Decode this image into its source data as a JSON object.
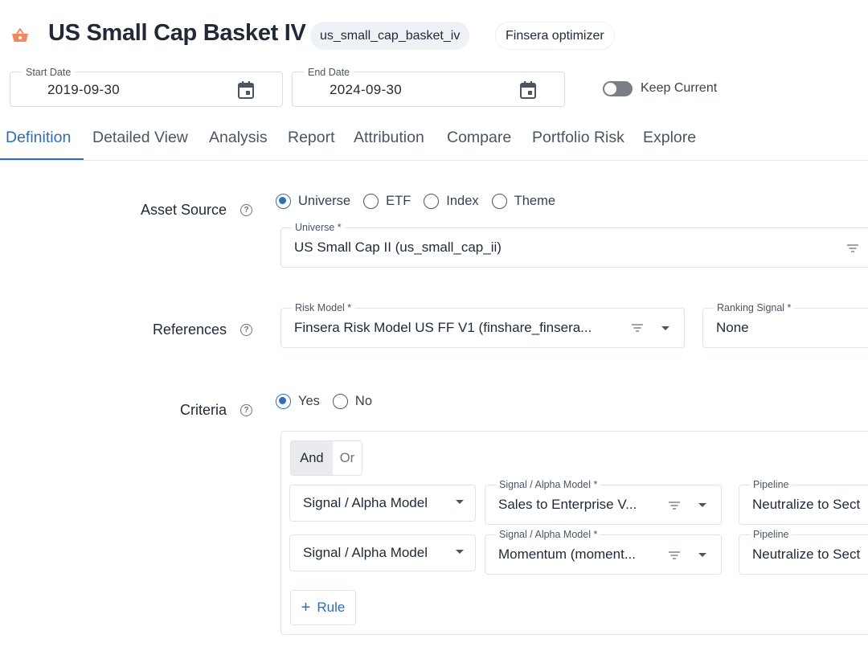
{
  "header": {
    "title": "US Small Cap Basket IV",
    "icon": "basket-icon",
    "chips": [
      "us_small_cap_basket_iv",
      "Finsera optimizer"
    ]
  },
  "dates": {
    "start": {
      "label": "Start Date",
      "value": "2019-09-30"
    },
    "end": {
      "label": "End Date",
      "value": "2024-09-30"
    },
    "keep_current_label": "Keep Current",
    "keep_current_on": false
  },
  "tabs": [
    {
      "label": "Definition",
      "active": true
    },
    {
      "label": "Detailed View"
    },
    {
      "label": "Analysis"
    },
    {
      "label": "Report"
    },
    {
      "label": "Attribution"
    },
    {
      "label": "Compare"
    },
    {
      "label": "Portfolio Risk"
    },
    {
      "label": "Explore"
    }
  ],
  "asset_source": {
    "label": "Asset Source",
    "help": "?",
    "options": [
      "Universe",
      "ETF",
      "Index",
      "Theme"
    ],
    "selected": "Universe",
    "universe_field": {
      "label": "Universe *",
      "value": "US Small Cap II (us_small_cap_ii)"
    }
  },
  "references": {
    "label": "References",
    "help": "?",
    "risk_model": {
      "label": "Risk Model *",
      "value": "Finsera Risk Model US FF V1 (finshare_finsera..."
    },
    "ranking_signal": {
      "label": "Ranking Signal *",
      "value": "None"
    }
  },
  "criteria": {
    "label": "Criteria",
    "help": "?",
    "options": [
      "Yes",
      "No"
    ],
    "selected": "Yes",
    "logic": {
      "and": "And",
      "or": "Or",
      "selected": "And"
    },
    "rules": [
      {
        "type": "Signal / Alpha Model",
        "signal_label": "Signal / Alpha Model *",
        "signal_value": "Sales to Enterprise V...",
        "pipeline_label": "Pipeline",
        "pipeline_value": "Neutralize to Sect"
      },
      {
        "type": "Signal / Alpha Model",
        "signal_label": "Signal / Alpha Model *",
        "signal_value": "Momentum (moment...",
        "pipeline_label": "Pipeline",
        "pipeline_value": "Neutralize to Sect"
      }
    ],
    "add_rule_label": "Rule"
  },
  "colors": {
    "accent": "#2f6db5",
    "brand_icon": "#f08a5d"
  }
}
